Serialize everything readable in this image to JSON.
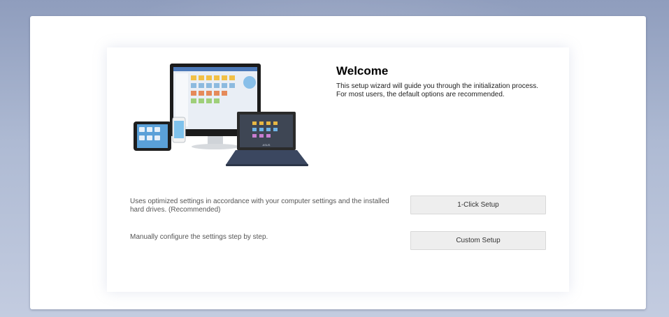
{
  "welcome": {
    "title": "Welcome",
    "description": "This setup wizard will guide you through the initialization process. For most users, the default options are recommended."
  },
  "options": [
    {
      "description": "Uses optimized settings in accordance with your computer settings and the installed hard drives. (Recommended)",
      "button_label": "1-Click Setup"
    },
    {
      "description": "Manually configure the settings step by step.",
      "button_label": "Custom Setup"
    }
  ],
  "hero_image": {
    "icon": "devices-illustration-icon",
    "laptop_brand": "ASUS"
  },
  "colors": {
    "background_top": "#8f9dbd",
    "button_bg": "#eeeeee",
    "button_border": "#d8d8d8"
  }
}
